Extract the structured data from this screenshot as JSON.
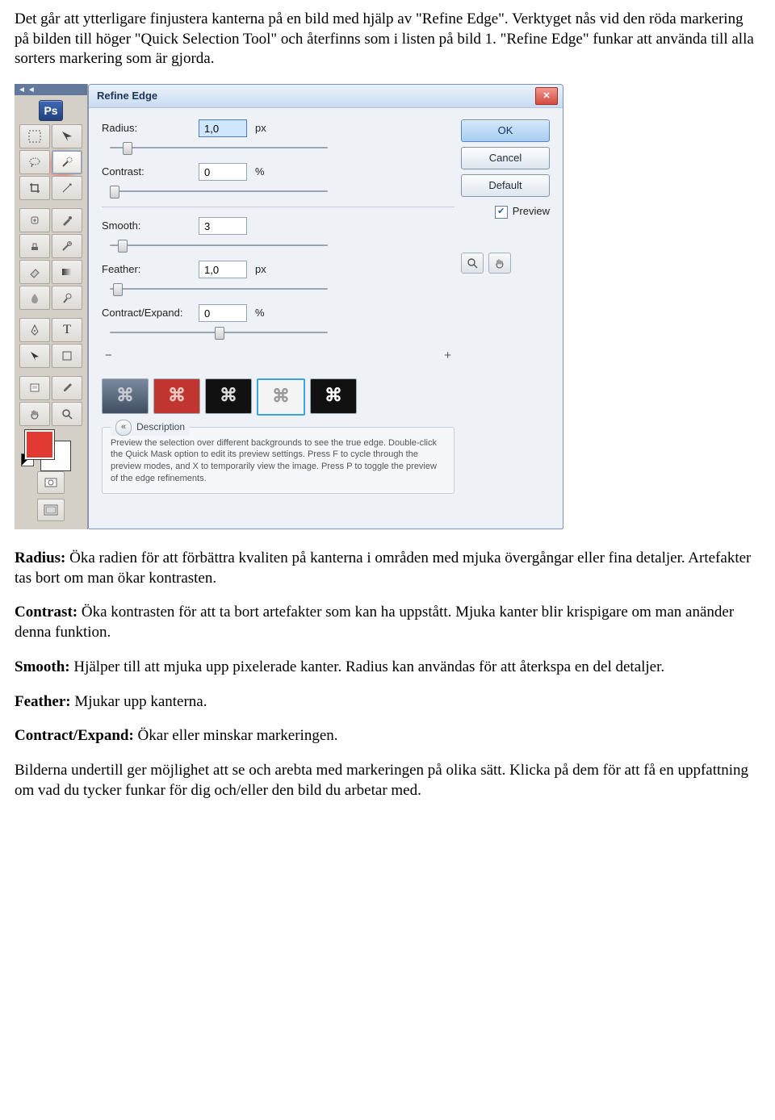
{
  "doc": {
    "p1": "Det går att ytterligare finjustera kanterna på en bild med hjälp av \"Refine Edge\". Verktyget nås vid den röda markering på bilden till höger \"Quick Selection Tool\" och återfinns som i listen på bild 1. \"Refine Edge\" funkar att använda till alla sorters markering som är gjorda.",
    "radius_b": "Radius:",
    "radius_t": " Öka radien för att förbättra kvaliten på kanterna i områden med mjuka övergångar eller fina detaljer. Artefakter tas bort om man ökar kontrasten.",
    "contrast_b": "Contrast:",
    "contrast_t": " Öka kontrasten för att ta bort artefakter som kan ha uppstått. Mjuka kanter blir krispigare om man anänder denna funktion.",
    "smooth_b": "Smooth:",
    "smooth_t": " Hjälper till att mjuka upp pixelerade kanter. Radius kan användas för att återkspa en del detaljer.",
    "feather_b": "Feather:",
    "feather_t": " Mjukar upp kanterna.",
    "ce_b": "Contract/Expand:",
    "ce_t": " Ökar eller minskar markeringen.",
    "p_last": "Bilderna undertill ger möjlighet att se och arebta med markeringen på olika sätt. Klicka på dem för att få en uppfattning om vad du tycker funkar för dig och/eller den bild du arbetar med."
  },
  "toolbox": {
    "ps": "Ps"
  },
  "dialog": {
    "title": "Refine Edge",
    "ok": "OK",
    "cancel": "Cancel",
    "default": "Default",
    "preview": "Preview",
    "radius_label": "Radius:",
    "radius_value": "1,0",
    "radius_unit": "px",
    "contrast_label": "Contrast:",
    "contrast_value": "0",
    "contrast_unit": "%",
    "smooth_label": "Smooth:",
    "smooth_value": "3",
    "feather_label": "Feather:",
    "feather_value": "1,0",
    "feather_unit": "px",
    "ce_label": "Contract/Expand:",
    "ce_value": "0",
    "ce_unit": "%",
    "minus": "−",
    "plus": "+",
    "desc_head": "Description",
    "desc_text": "Preview the selection over different backgrounds to see the true edge. Double-click the Quick Mask option to edit its preview settings. Press F to cycle through the preview modes, and X to temporarily view the image. Press P to toggle the preview of the edge refinements."
  }
}
